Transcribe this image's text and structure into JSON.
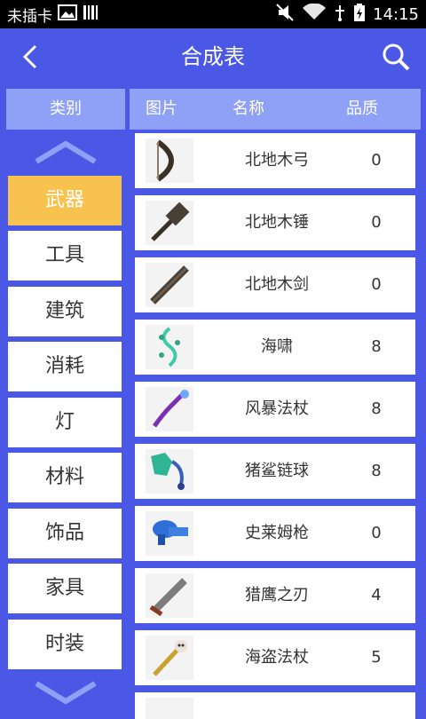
{
  "status_bar": {
    "carrier": "未插卡",
    "time": "14:15",
    "icons": [
      "image-icon",
      "barcode-icon",
      "mute-icon",
      "wifi-icon",
      "usb-icon",
      "battery-icon"
    ]
  },
  "app_bar": {
    "title": "合成表",
    "back_icon": "chevron-left-icon",
    "search_icon": "search-icon"
  },
  "sidebar": {
    "header": "类别",
    "items": [
      {
        "label": "武器",
        "active": true
      },
      {
        "label": "工具",
        "active": false
      },
      {
        "label": "建筑",
        "active": false
      },
      {
        "label": "消耗",
        "active": false
      },
      {
        "label": "灯",
        "active": false
      },
      {
        "label": "材料",
        "active": false
      },
      {
        "label": "饰品",
        "active": false
      },
      {
        "label": "家具",
        "active": false
      },
      {
        "label": "时装",
        "active": false
      }
    ]
  },
  "table": {
    "columns": [
      "图片",
      "名称",
      "品质"
    ],
    "rows": [
      {
        "name": "北地木弓",
        "quality": "0",
        "icon": "bow-icon"
      },
      {
        "name": "北地木锤",
        "quality": "0",
        "icon": "hammer-icon"
      },
      {
        "name": "北地木剑",
        "quality": "0",
        "icon": "sword-icon"
      },
      {
        "name": "海啸",
        "quality": "8",
        "icon": "tsunami-icon"
      },
      {
        "name": "风暴法杖",
        "quality": "8",
        "icon": "staff-icon"
      },
      {
        "name": "猪鲨链球",
        "quality": "8",
        "icon": "flail-icon"
      },
      {
        "name": "史莱姆枪",
        "quality": "0",
        "icon": "slime-gun-icon"
      },
      {
        "name": "猎鹰之刃",
        "quality": "4",
        "icon": "blade-icon"
      },
      {
        "name": "海盗法杖",
        "quality": "5",
        "icon": "pirate-staff-icon"
      }
    ]
  },
  "colors": {
    "primary": "#4b58e6",
    "header": "#8ea1f6",
    "active": "#f7c24d"
  }
}
